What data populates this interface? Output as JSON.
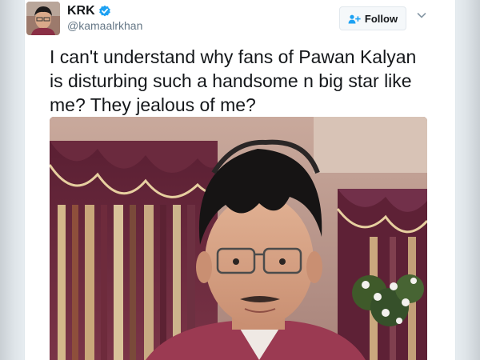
{
  "tweet": {
    "display_name": "KRK",
    "handle": "@kamaalrkhan",
    "follow_label": "Follow",
    "text": "I can't understand why fans of Pawan Kalyan is disturbing such a handsome n big star like me? They jealous of me?"
  },
  "colors": {
    "text": "#14171a",
    "muted": "#657786",
    "verified": "#1da1f2",
    "follow_icon": "#1da1f2",
    "page_bg": "#e6ecf0"
  },
  "icons": {
    "verified": "verified-badge-icon",
    "follow": "follow-person-plus-icon",
    "caret": "chevron-down-icon"
  }
}
